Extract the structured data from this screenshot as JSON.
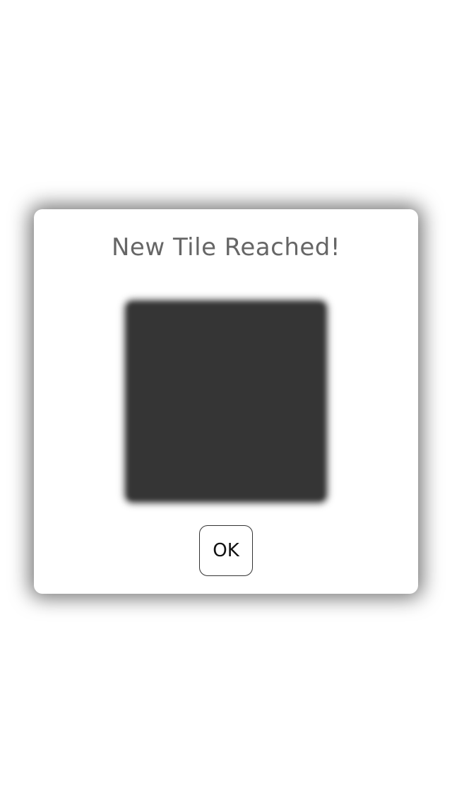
{
  "dialog": {
    "title": "New Tile Reached!",
    "tile": {
      "color": "#353535",
      "label": ""
    },
    "ok_label": "OK"
  },
  "colors": {
    "background": "#ffffff",
    "dialog_bg": "#ffffff",
    "title_text": "#666666",
    "tile": "#353535"
  }
}
